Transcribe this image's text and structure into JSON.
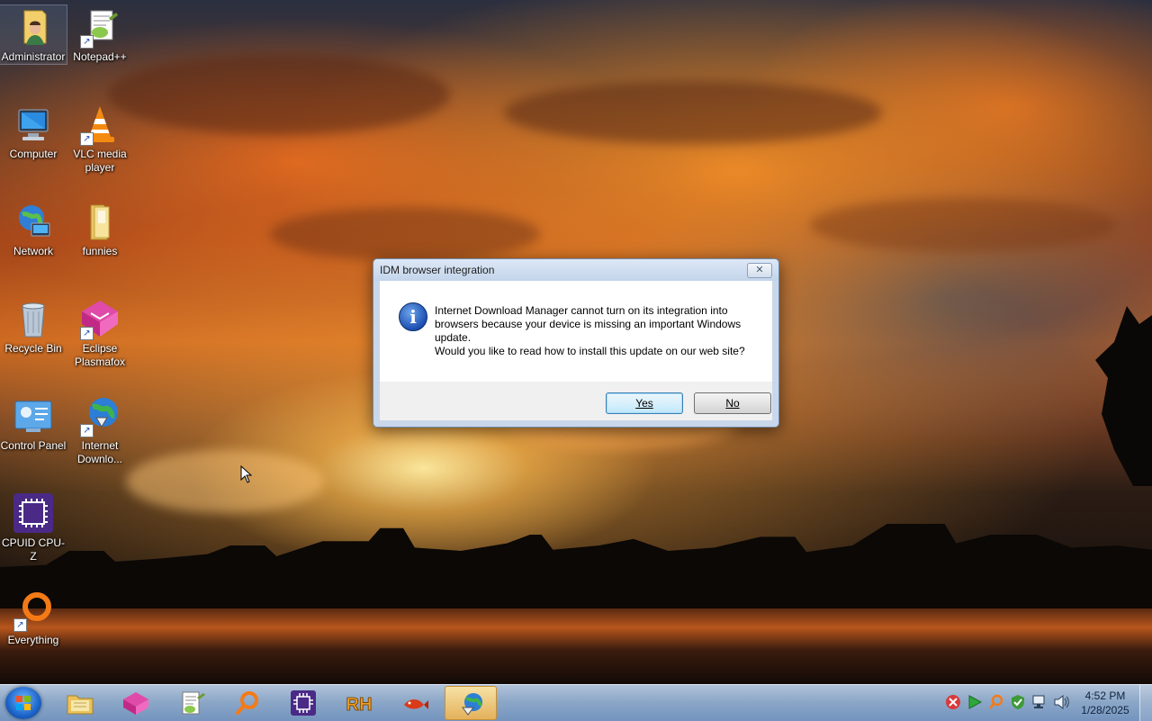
{
  "desktop": {
    "icons": [
      {
        "label": "Administrator",
        "icon": "user-folder-icon"
      },
      {
        "label": "Notepad++",
        "icon": "notepad-plus-plus-icon"
      },
      {
        "label": "Computer",
        "icon": "computer-icon"
      },
      {
        "label": "VLC media player",
        "icon": "vlc-cone-icon"
      },
      {
        "label": "Network",
        "icon": "network-globe-icon"
      },
      {
        "label": "funnies",
        "icon": "folder-icon"
      },
      {
        "label": "Recycle Bin",
        "icon": "recycle-bin-icon"
      },
      {
        "label": "Eclipse Plasmafox",
        "icon": "plasmafox-icon"
      },
      {
        "label": "Control Panel",
        "icon": "control-panel-icon"
      },
      {
        "label": "Internet Downlo...",
        "icon": "idm-globe-icon"
      },
      {
        "label": "CPUID CPU-Z",
        "icon": "cpu-z-chip-icon"
      },
      {
        "label": "Everything",
        "icon": "everything-search-icon"
      }
    ]
  },
  "dialog": {
    "title": "IDM browser integration",
    "close_label": "✕",
    "icon": "info-icon",
    "message_lines": [
      "Internet Download Manager cannot turn on its integration into",
      "browsers because your device is missing an important Windows",
      "update.",
      "Would you like to read how to install this update on our web site?"
    ],
    "yes_label": "Yes",
    "no_label": "No"
  },
  "taskbar": {
    "pinned": [
      {
        "name": "file-explorer-icon"
      },
      {
        "name": "plasmafox-icon"
      },
      {
        "name": "notepad-plus-plus-icon"
      },
      {
        "name": "everything-search-icon"
      },
      {
        "name": "cpu-z-chip-icon"
      },
      {
        "name": "rh-icon",
        "text": "RH"
      },
      {
        "name": "fish-icon"
      },
      {
        "name": "idm-globe-icon",
        "active": true
      }
    ],
    "tray_icons": [
      "idm-tray-icon",
      "play-icon",
      "search-tray-icon",
      "security-shield-icon",
      "network-tray-icon",
      "volume-icon"
    ],
    "clock": {
      "time": "4:52 PM",
      "date": "1/28/2025"
    }
  },
  "colors": {
    "dialog_default_button_border": "#3c7fb1",
    "taskbar": "#96b4d7",
    "active_task": "#f0b450"
  }
}
